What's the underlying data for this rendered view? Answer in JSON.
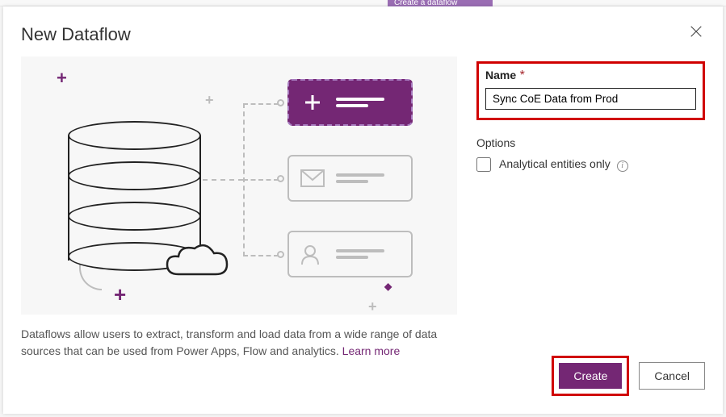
{
  "ribbon": "Create a dataflow",
  "dialog": {
    "title": "New Dataflow",
    "description": "Dataflows allow users to extract, transform and load data from a wide range of data sources that can be used from Power Apps, Flow and analytics. ",
    "learn_more": "Learn more"
  },
  "form": {
    "name_label": "Name",
    "name_value": "Sync CoE Data from Prod",
    "options_label": "Options",
    "analytical_label": "Analytical entities only"
  },
  "buttons": {
    "create": "Create",
    "cancel": "Cancel"
  }
}
